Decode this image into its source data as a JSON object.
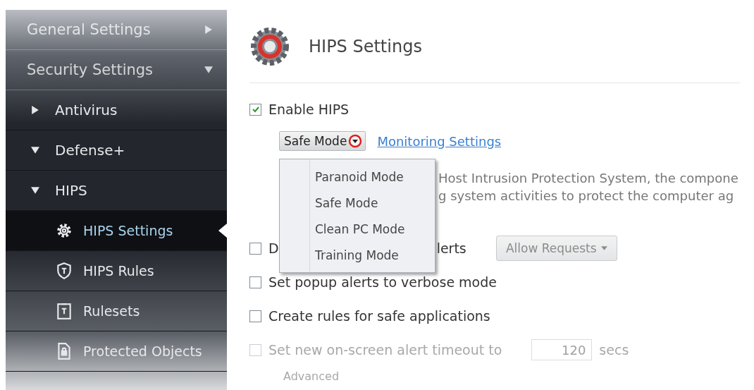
{
  "sidebar": {
    "sections": [
      {
        "label": "General Settings",
        "expanded": false
      },
      {
        "label": "Security Settings",
        "expanded": true,
        "children": [
          {
            "label": "Antivirus",
            "expanded": false
          },
          {
            "label": "Defense+",
            "expanded": true,
            "children": [
              {
                "label": "HIPS",
                "expanded": true,
                "children": [
                  {
                    "label": "HIPS Settings",
                    "kind": "gear",
                    "selected": true
                  },
                  {
                    "label": "HIPS Rules",
                    "kind": "shield",
                    "selected": false
                  },
                  {
                    "label": "Rulesets",
                    "kind": "clipboard",
                    "selected": false
                  },
                  {
                    "label": "Protected Objects",
                    "kind": "lock",
                    "selected": false
                  }
                ]
              }
            ]
          }
        ]
      }
    ]
  },
  "header": {
    "title": "HIPS Settings"
  },
  "enable_hips": {
    "label": "Enable HIPS",
    "checked": true
  },
  "mode_dropdown": {
    "value": "Safe Mode",
    "open": true,
    "options": [
      "Paranoid Mode",
      "Safe Mode",
      "Clean PC Mode",
      "Training Mode"
    ]
  },
  "monitoring_link": "Monitoring Settings",
  "description": [
    "Host Intrusion Protection System, the compone",
    "g system activities to protect the computer ag"
  ],
  "options": [
    {
      "kind": "checkbox-select",
      "label_start": "D",
      "label_end": "lerts",
      "checked": false,
      "disabled": false,
      "select": {
        "value": "Allow Requests",
        "disabled": true
      }
    },
    {
      "kind": "checkbox",
      "label": "Set popup alerts to verbose mode",
      "checked": false,
      "disabled": false
    },
    {
      "kind": "checkbox",
      "label": "Create rules for safe applications",
      "checked": false,
      "disabled": false
    },
    {
      "kind": "checkbox-input",
      "label": "Set new on-screen alert timeout to",
      "checked": false,
      "disabled": true,
      "value": "120",
      "unit": "secs"
    }
  ],
  "advanced": "Advanced"
}
